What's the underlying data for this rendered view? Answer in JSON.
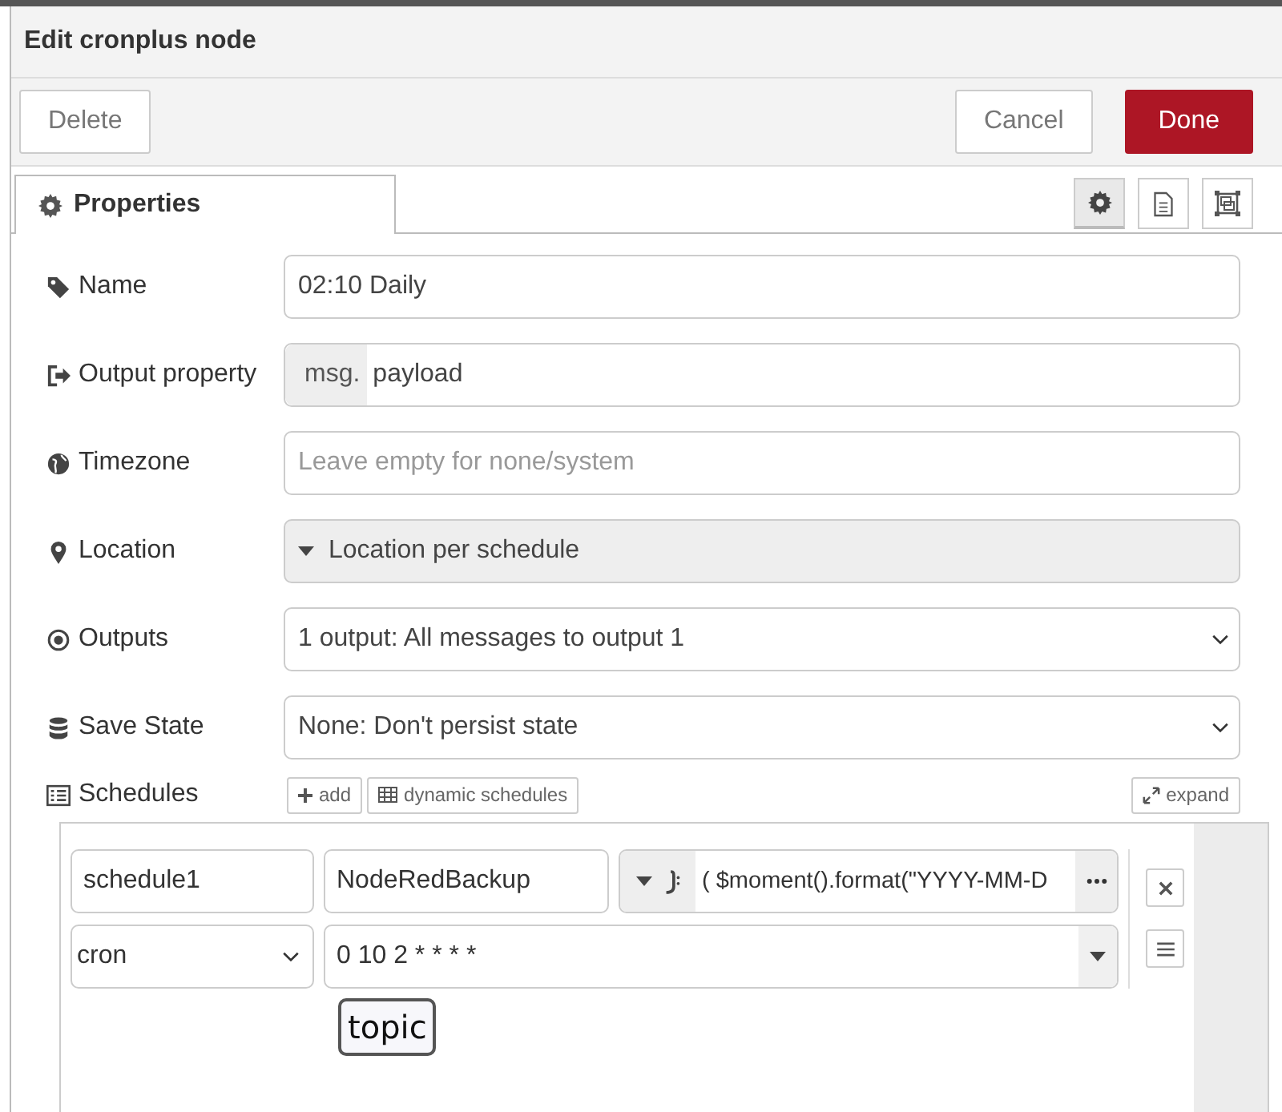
{
  "dialog": {
    "title": "Edit cronplus node"
  },
  "buttons": [
    {
      "label": "Delete",
      "kind": "plain"
    },
    {
      "label": "Cancel",
      "kind": "plain"
    },
    {
      "label": "Done",
      "kind": "primary"
    }
  ],
  "tabs": [
    {
      "label": "Properties",
      "selected": true
    }
  ],
  "side_tabs": [
    {
      "kind": "settings",
      "selected": true
    },
    {
      "kind": "description",
      "selected": false
    },
    {
      "kind": "appearance",
      "selected": false
    }
  ],
  "fields": [
    {
      "label": "Name",
      "kind": "text",
      "value": "02:10 Daily"
    },
    {
      "label": "Output property",
      "kind": "typed",
      "prefix": "msg.",
      "value": "payload"
    },
    {
      "label": "Timezone",
      "kind": "text",
      "placeholder": "Leave empty for none/system"
    },
    {
      "label": "Location",
      "kind": "menu",
      "value": "Location per schedule"
    },
    {
      "label": "Outputs",
      "kind": "select",
      "value": "1 output: All messages to output 1"
    },
    {
      "label": "Save State",
      "kind": "select",
      "value": "None: Don't persist state"
    }
  ],
  "schedules": {
    "label": "Schedules",
    "add": "add",
    "dynamic": "dynamic schedules",
    "expand": "expand",
    "rows": [
      {
        "name": "schedule1",
        "topic": "NodeRedBackup",
        "payload": "( $moment().format(\"YYYY-MM-D",
        "type": "cron",
        "expression": "0 10 2 * * * *"
      }
    ],
    "tooltip": "topic"
  }
}
